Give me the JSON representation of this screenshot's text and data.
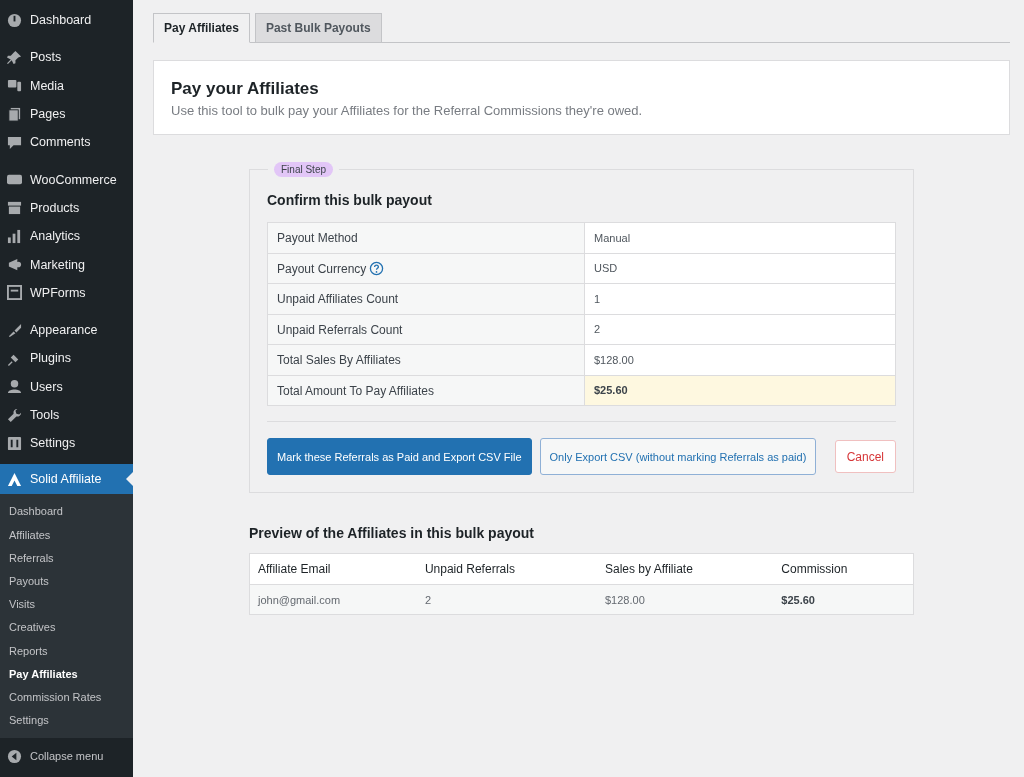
{
  "sidebar": {
    "groups": [
      [
        {
          "label": "Dashboard"
        }
      ],
      [
        {
          "label": "Posts"
        },
        {
          "label": "Media"
        },
        {
          "label": "Pages"
        },
        {
          "label": "Comments"
        }
      ],
      [
        {
          "label": "WooCommerce"
        },
        {
          "label": "Products"
        },
        {
          "label": "Analytics"
        },
        {
          "label": "Marketing"
        },
        {
          "label": "WPForms"
        }
      ],
      [
        {
          "label": "Appearance"
        },
        {
          "label": "Plugins"
        },
        {
          "label": "Users"
        },
        {
          "label": "Tools"
        },
        {
          "label": "Settings"
        }
      ]
    ],
    "active_item": {
      "label": "Solid Affiliate",
      "selected": true
    },
    "submenu": [
      {
        "label": "Dashboard",
        "selected": false
      },
      {
        "label": "Affiliates",
        "selected": false
      },
      {
        "label": "Referrals",
        "selected": false
      },
      {
        "label": "Payouts",
        "selected": false
      },
      {
        "label": "Visits",
        "selected": false
      },
      {
        "label": "Creatives",
        "selected": false
      },
      {
        "label": "Reports",
        "selected": false
      },
      {
        "label": "Pay Affiliates",
        "selected": true
      },
      {
        "label": "Commission Rates",
        "selected": false
      },
      {
        "label": "Settings",
        "selected": false
      }
    ],
    "collapse": "Collapse menu"
  },
  "tabs": [
    {
      "label": "Pay Affiliates",
      "selected": true
    },
    {
      "label": "Past Bulk Payouts",
      "selected": false
    }
  ],
  "header": {
    "title": "Pay your Affiliates",
    "description": "Use this tool to bulk pay your Affiliates for the Referral Commissions they're owed."
  },
  "step": {
    "badge": "Final Step",
    "title": "Confirm this bulk payout",
    "rows": [
      {
        "label": "Payout Method",
        "value": "Manual",
        "help": false,
        "highlighted": false
      },
      {
        "label": "Payout Currency",
        "value": "USD",
        "help": true,
        "highlighted": false
      },
      {
        "label": "Unpaid Affiliates Count",
        "value": "1",
        "help": false,
        "highlighted": false
      },
      {
        "label": "Unpaid Referrals Count",
        "value": "2",
        "help": false,
        "highlighted": false
      },
      {
        "label": "Total Sales By Affiliates",
        "value": "$128.00",
        "help": false,
        "highlighted": false
      },
      {
        "label": "Total Amount To Pay Affiliates",
        "value": "$25.60",
        "help": false,
        "highlighted": true
      }
    ],
    "buttons": {
      "primary": "Mark these Referrals as Paid and Export CSV File",
      "secondary": "Only Export CSV (without marking Referrals as paid)",
      "cancel": "Cancel"
    }
  },
  "preview": {
    "title": "Preview of the Affiliates in this bulk payout",
    "columns": [
      "Affiliate Email",
      "Unpaid Referrals",
      "Sales by Affiliate",
      "Commission"
    ],
    "rows": [
      [
        "john@gmail.com",
        "2",
        "$128.00",
        "$25.60"
      ]
    ]
  }
}
